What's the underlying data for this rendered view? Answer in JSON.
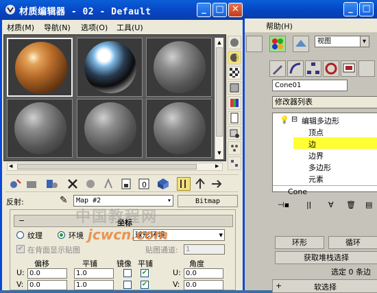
{
  "material_editor": {
    "title": "材质编辑器 - 02 - Default",
    "menu": [
      "材质(M)",
      "导航(N)",
      "选项(O)",
      "工具(U)"
    ],
    "map_label": "反射:",
    "map_name": "Map #2",
    "map_type": "Bitmap",
    "rollout_title": "坐标",
    "texture_label": "纹理",
    "env_label": "环境",
    "mapping_value": "球形环境",
    "show_back_label": "在背面显示贴图",
    "map_channel_label": "贴图通道:",
    "map_channel_value": "1",
    "col_offset": "偏移",
    "col_tiling": "平铺",
    "col_mirror": "镜像",
    "col_tiling2": "平铺",
    "col_angle": "角度",
    "row_u": "U:",
    "row_v": "V:",
    "u_offset": "0.0",
    "u_tiling": "1.0",
    "u_angle": "0.0",
    "v_offset": "0.0",
    "v_tiling": "1.0",
    "v_angle": "0.0"
  },
  "max_window": {
    "menu_help": "帮助(H)",
    "view_dropdown": "视图",
    "object_name": "Cone01",
    "modifier_list": "修改器列表",
    "stack": {
      "root": "编辑多边形",
      "items": [
        "顶点",
        "边",
        "边界",
        "多边形",
        "元素"
      ],
      "selected": "边",
      "base": "Cone"
    },
    "buttons": {
      "ring": "环形",
      "loop": "循环",
      "get_stack": "获取堆栈选择",
      "soft_select": "软选择"
    },
    "status": "选定 0 条边"
  },
  "watermark": {
    "line1": "中国教程网",
    "line2": "jcwcn.com"
  }
}
